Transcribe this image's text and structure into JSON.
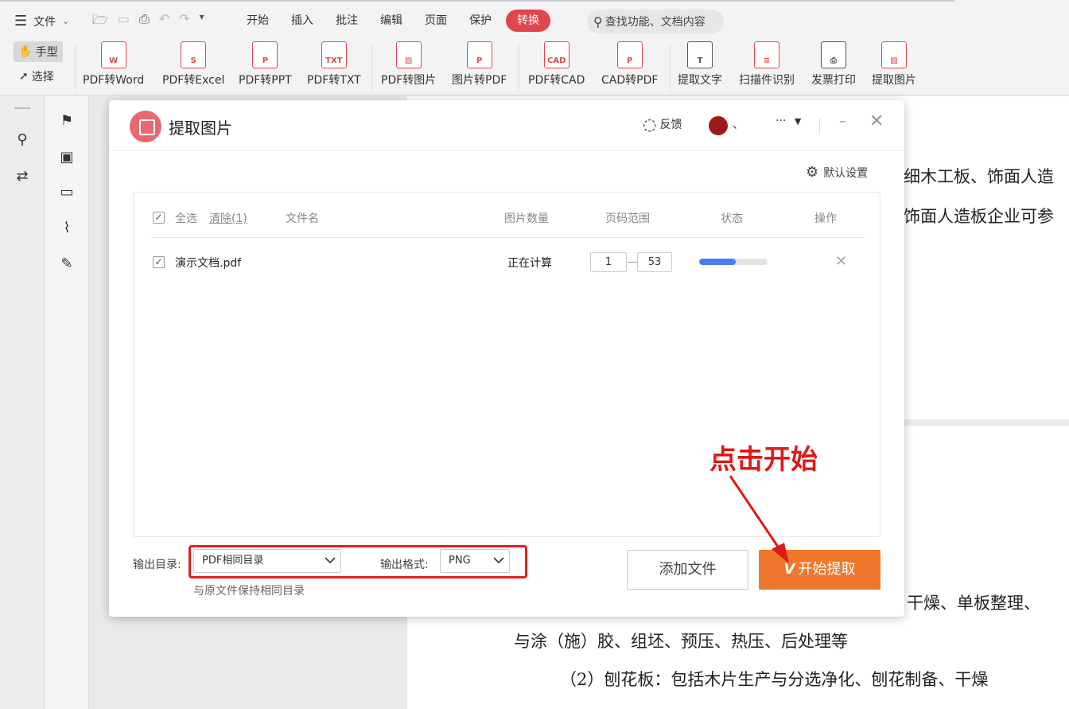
{
  "menubar": {
    "file_label": "文件",
    "tabs": [
      "开始",
      "插入",
      "批注",
      "编辑",
      "页面",
      "保护",
      "转换"
    ],
    "active_tab": "转换",
    "search_placeholder": "查找功能、文档内容"
  },
  "ribbon": {
    "hand_tool": "手型",
    "select_tool": "选择",
    "buttons": [
      {
        "label": "PDF转Word",
        "icon": "W"
      },
      {
        "label": "PDF转Excel",
        "icon": "S"
      },
      {
        "label": "PDF转PPT",
        "icon": "P"
      },
      {
        "label": "PDF转TXT",
        "icon": "TXT"
      },
      {
        "label": "PDF转图片",
        "icon": "img"
      },
      {
        "label": "图片转PDF",
        "icon": "pdf"
      },
      {
        "label": "PDF转CAD",
        "icon": "CAD"
      },
      {
        "label": "CAD转PDF",
        "icon": "pdf"
      },
      {
        "label": "提取文字",
        "icon": "T"
      },
      {
        "label": "扫描件识别",
        "icon": "scan"
      },
      {
        "label": "发票打印",
        "icon": "print"
      },
      {
        "label": "提取图片",
        "icon": "img"
      }
    ]
  },
  "dialog": {
    "title": "提取图片",
    "feedback": "反馈",
    "user_suffix": "、",
    "more": "···",
    "default_settings": "默认设置",
    "header": {
      "select_all": "全选",
      "clear": "清除(1)",
      "file_name": "文件名",
      "image_count": "图片数量",
      "page_range": "页码范围",
      "status": "状态",
      "action": "操作"
    },
    "files": [
      {
        "name": "演示文档.pdf",
        "count": "正在计算",
        "page_from": "1",
        "page_to": "53",
        "progress": 0.53
      }
    ],
    "output_dir_label": "输出目录:",
    "output_dir_value": "PDF相同目录",
    "output_dir_hint": "与原文件保持相同目录",
    "output_format_label": "输出格式:",
    "output_format_value": "PNG",
    "add_file": "添加文件",
    "start_extract": "开始提取"
  },
  "annotation": "点击开始",
  "document": {
    "lines": [
      "细木工板、饰面人造",
      "饰面人造板企业可参",
      "干燥、单板整理、",
      "与涂（施）胶、组坯、预压、热压、后处理等",
      "（2）刨花板：包括木片生产与分选净化、刨花制备、干燥"
    ]
  },
  "colors": {
    "accent": "#e0464b",
    "start_button": "#f0782d",
    "progress": "#4a7de8",
    "annotation": "#e01818"
  }
}
